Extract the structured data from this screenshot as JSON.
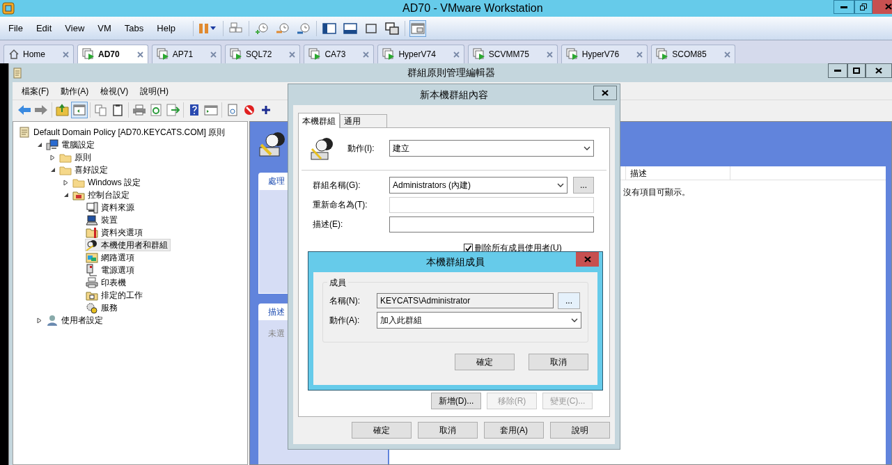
{
  "vmware": {
    "title": "AD70 - VMware Workstation",
    "menu": [
      "File",
      "Edit",
      "View",
      "VM",
      "Tabs",
      "Help"
    ],
    "tabs": [
      {
        "label": "Home",
        "kind": "home",
        "selected": false
      },
      {
        "label": "AD70",
        "kind": "vm",
        "selected": true
      },
      {
        "label": "AP71",
        "kind": "vm",
        "selected": false
      },
      {
        "label": "SQL72",
        "kind": "vm",
        "selected": false
      },
      {
        "label": "CA73",
        "kind": "vm",
        "selected": false
      },
      {
        "label": "HyperV74",
        "kind": "vm",
        "selected": false
      },
      {
        "label": "SCVMM75",
        "kind": "vm",
        "selected": false
      },
      {
        "label": "HyperV76",
        "kind": "vm",
        "selected": false
      },
      {
        "label": "SCOM85",
        "kind": "vm",
        "selected": false
      }
    ]
  },
  "editor": {
    "title": "群組原則管理編輯器",
    "menu": [
      "檔案(F)",
      "動作(A)",
      "檢視(V)",
      "說明(H)"
    ],
    "tree": {
      "label": "Default Domain Policy [AD70.KEYCATS.COM] 原則",
      "kind": "policy",
      "selected": false,
      "children": [
        {
          "label": "電腦設定",
          "kind": "computer",
          "expanded": true,
          "selected": false,
          "children": [
            {
              "label": "原則",
              "kind": "folder",
              "expanded": false,
              "selected": false
            },
            {
              "label": "喜好設定",
              "kind": "folder",
              "expanded": true,
              "selected": false,
              "children": [
                {
                  "label": "Windows 設定",
                  "kind": "folder",
                  "expanded": false,
                  "selected": false
                },
                {
                  "label": "控制台設定",
                  "kind": "control",
                  "expanded": true,
                  "selected": false,
                  "children": [
                    {
                      "label": "資料來源",
                      "kind": "datasource",
                      "selected": false
                    },
                    {
                      "label": "裝置",
                      "kind": "device",
                      "selected": false
                    },
                    {
                      "label": "資料夾選項",
                      "kind": "folderopts",
                      "selected": false
                    },
                    {
                      "label": "本機使用者和群組",
                      "kind": "users",
                      "selected": true
                    },
                    {
                      "label": "網路選項",
                      "kind": "network",
                      "selected": false
                    },
                    {
                      "label": "電源選項",
                      "kind": "power",
                      "selected": false
                    },
                    {
                      "label": "印表機",
                      "kind": "printer",
                      "selected": false
                    },
                    {
                      "label": "排定的工作",
                      "kind": "task",
                      "selected": false
                    },
                    {
                      "label": "服務",
                      "kind": "services",
                      "selected": false
                    }
                  ]
                }
              ]
            }
          ]
        },
        {
          "label": "使用者設定",
          "kind": "user",
          "expanded": false,
          "selected": false
        }
      ]
    },
    "details": {
      "processing_tab": "處理",
      "description_tab": "描述",
      "description_text": "未選",
      "column_header": "描述",
      "empty_text": "沒有項目可顯示。"
    }
  },
  "properties_dialog": {
    "title": "新本機群組內容",
    "tabs": [
      {
        "label": "本機群組",
        "selected": true
      },
      {
        "label": "通用",
        "selected": false
      }
    ],
    "action": {
      "label": "動作(I):",
      "value": "建立"
    },
    "group_name": {
      "label": "群組名稱(G):",
      "value": "Administrators (內建)",
      "browse": {
        "label": "...",
        "focused": false
      }
    },
    "rename": {
      "label": "重新命名為(T):",
      "disabled": true
    },
    "description": {
      "label": "描述(E):",
      "disabled": false
    },
    "delete_all_users": {
      "label": "刪除所有成員使用者(U)",
      "checked": true
    },
    "member_buttons": [
      {
        "label": "新增(D)...",
        "disabled": false
      },
      {
        "label": "移除(R)",
        "disabled": true
      },
      {
        "label": "變更(C)...",
        "disabled": true
      }
    ],
    "buttons": [
      "確定",
      "取消",
      "套用(A)",
      "說明"
    ]
  },
  "member_dialog": {
    "title": "本機群組成員",
    "group_label": "成員",
    "name": {
      "label": "名稱(N):",
      "value": "KEYCATS\\Administrator",
      "browse": {
        "label": "...",
        "focused": true
      }
    },
    "action": {
      "label": "動作(A):",
      "value": "加入此群組"
    },
    "buttons": [
      "確定",
      "取消"
    ]
  }
}
